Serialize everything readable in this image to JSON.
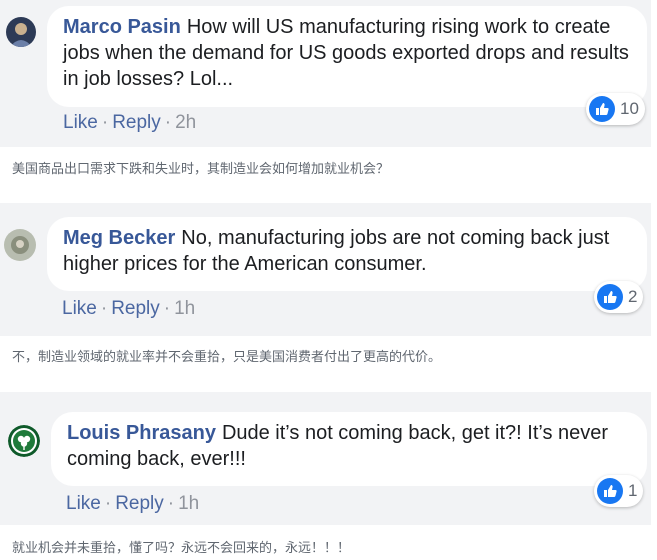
{
  "comments": [
    {
      "author": "Marco Pasin",
      "text": "How will US manufacturing rising work to create jobs when the demand for US goods exported drops and results in job losses? Lol...",
      "like_label": "Like",
      "reply_label": "Reply",
      "time": "2h",
      "reaction_count": "10",
      "translation": "美国商品出口需求下跌和失业时，其制造业会如何增加就业机会？"
    },
    {
      "author": "Meg Becker",
      "text": "No, manufacturing jobs are not coming back just higher prices for the American consumer.",
      "like_label": "Like",
      "reply_label": "Reply",
      "time": "1h",
      "reaction_count": "2",
      "translation": "不，制造业领域的就业率并不会重拾，只是美国消费者付出了更高的代价。"
    },
    {
      "author": "Louis Phrasany",
      "text": "Dude it’s not coming back, get it?! It’s never coming back, ever!!!",
      "like_label": "Like",
      "reply_label": "Reply",
      "time": "1h",
      "reaction_count": "1",
      "translation": "就业机会并未重拾，懂了吗？永远不会回来的，永远！！！"
    }
  ],
  "icons": {
    "reaction": "thumbs-up-icon"
  },
  "colors": {
    "author": "#385898",
    "link": "#4b67a1",
    "like_badge": "#1877f2",
    "panel": "#f2f3f5"
  }
}
